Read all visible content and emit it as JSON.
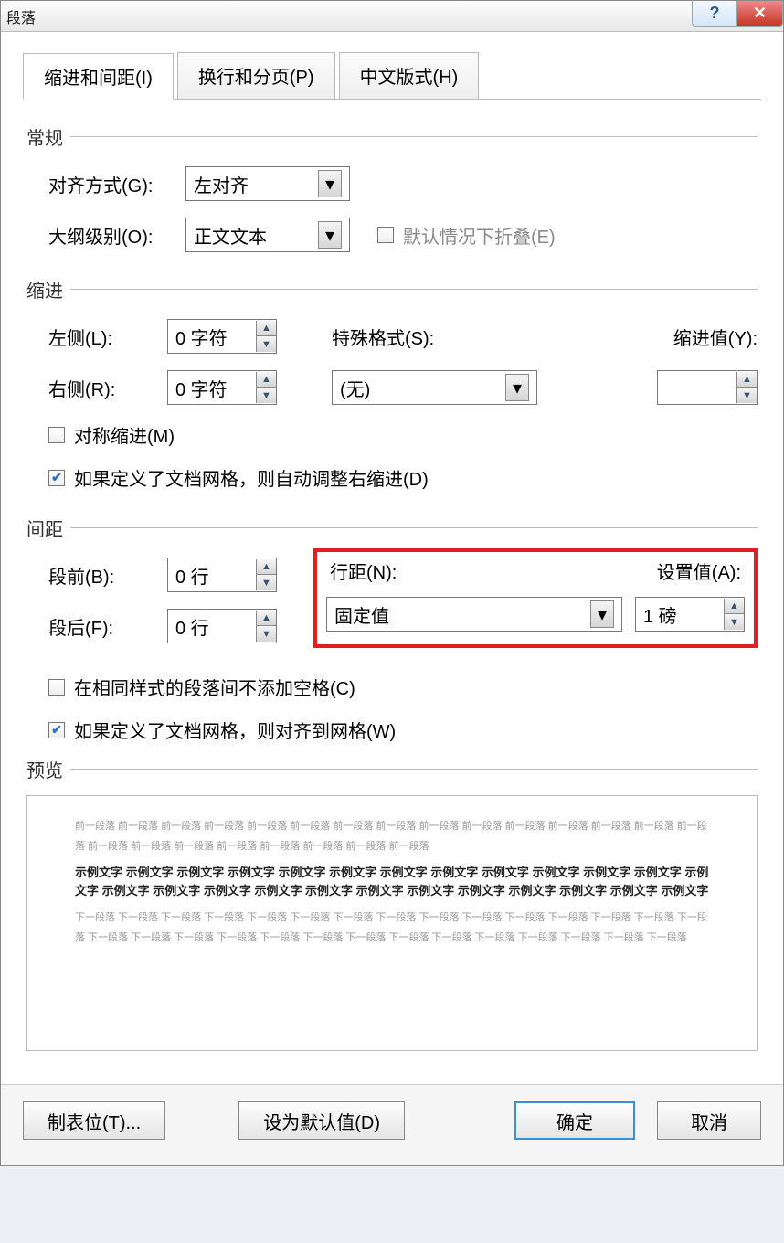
{
  "title": "段落",
  "tabs": {
    "t1": "缩进和间距(I)",
    "t2": "换行和分页(P)",
    "t3": "中文版式(H)"
  },
  "groups": {
    "general": "常规",
    "indent": "缩进",
    "spacing": "间距",
    "preview": "预览"
  },
  "general": {
    "align_label": "对齐方式(G):",
    "align_value": "左对齐",
    "outline_label": "大纲级别(O):",
    "outline_value": "正文文本",
    "collapse_label": "默认情况下折叠(E)"
  },
  "indent": {
    "left_label": "左侧(L):",
    "left_value": "0 字符",
    "right_label": "右侧(R):",
    "right_value": "0 字符",
    "special_label": "特殊格式(S):",
    "special_value": "(无)",
    "by_label": "缩进值(Y):",
    "by_value": "",
    "mirror_label": "对称缩进(M)",
    "grid_label": "如果定义了文档网格，则自动调整右缩进(D)"
  },
  "spacing": {
    "before_label": "段前(B):",
    "before_value": "0 行",
    "after_label": "段后(F):",
    "after_value": "0 行",
    "line_label": "行距(N):",
    "line_value": "固定值",
    "at_label": "设置值(A):",
    "at_value": "1 磅",
    "nospace_label": "在相同样式的段落间不添加空格(C)",
    "snap_label": "如果定义了文档网格，则对齐到网格(W)"
  },
  "preview": {
    "prev_para": "前一段落 前一段落 前一段落 前一段落 前一段落 前一段落 前一段落 前一段落 前一段落 前一段落 前一段落 前一段落 前一段落 前一段落 前一段落 前一段落 前一段落 前一段落 前一段落 前一段落 前一段落 前一段落 前一段落",
    "sample": "示例文字 示例文字 示例文字 示例文字 示例文字 示例文字 示例文字 示例文字 示例文字 示例文字 示例文字 示例文字 示例文字 示例文字 示例文字 示例文字 示例文字 示例文字 示例文字 示例文字 示例文字 示例文字 示例文字 示例文字 示例文字",
    "next_para": "下一段落 下一段落 下一段落 下一段落 下一段落 下一段落 下一段落 下一段落 下一段落 下一段落 下一段落 下一段落 下一段落 下一段落 下一段落 下一段落 下一段落 下一段落 下一段落 下一段落 下一段落 下一段落 下一段落 下一段落 下一段落 下一段落 下一段落 下一段落 下一段落"
  },
  "footer": {
    "tabs": "制表位(T)...",
    "default": "设为默认值(D)",
    "ok": "确定",
    "cancel": "取消"
  }
}
